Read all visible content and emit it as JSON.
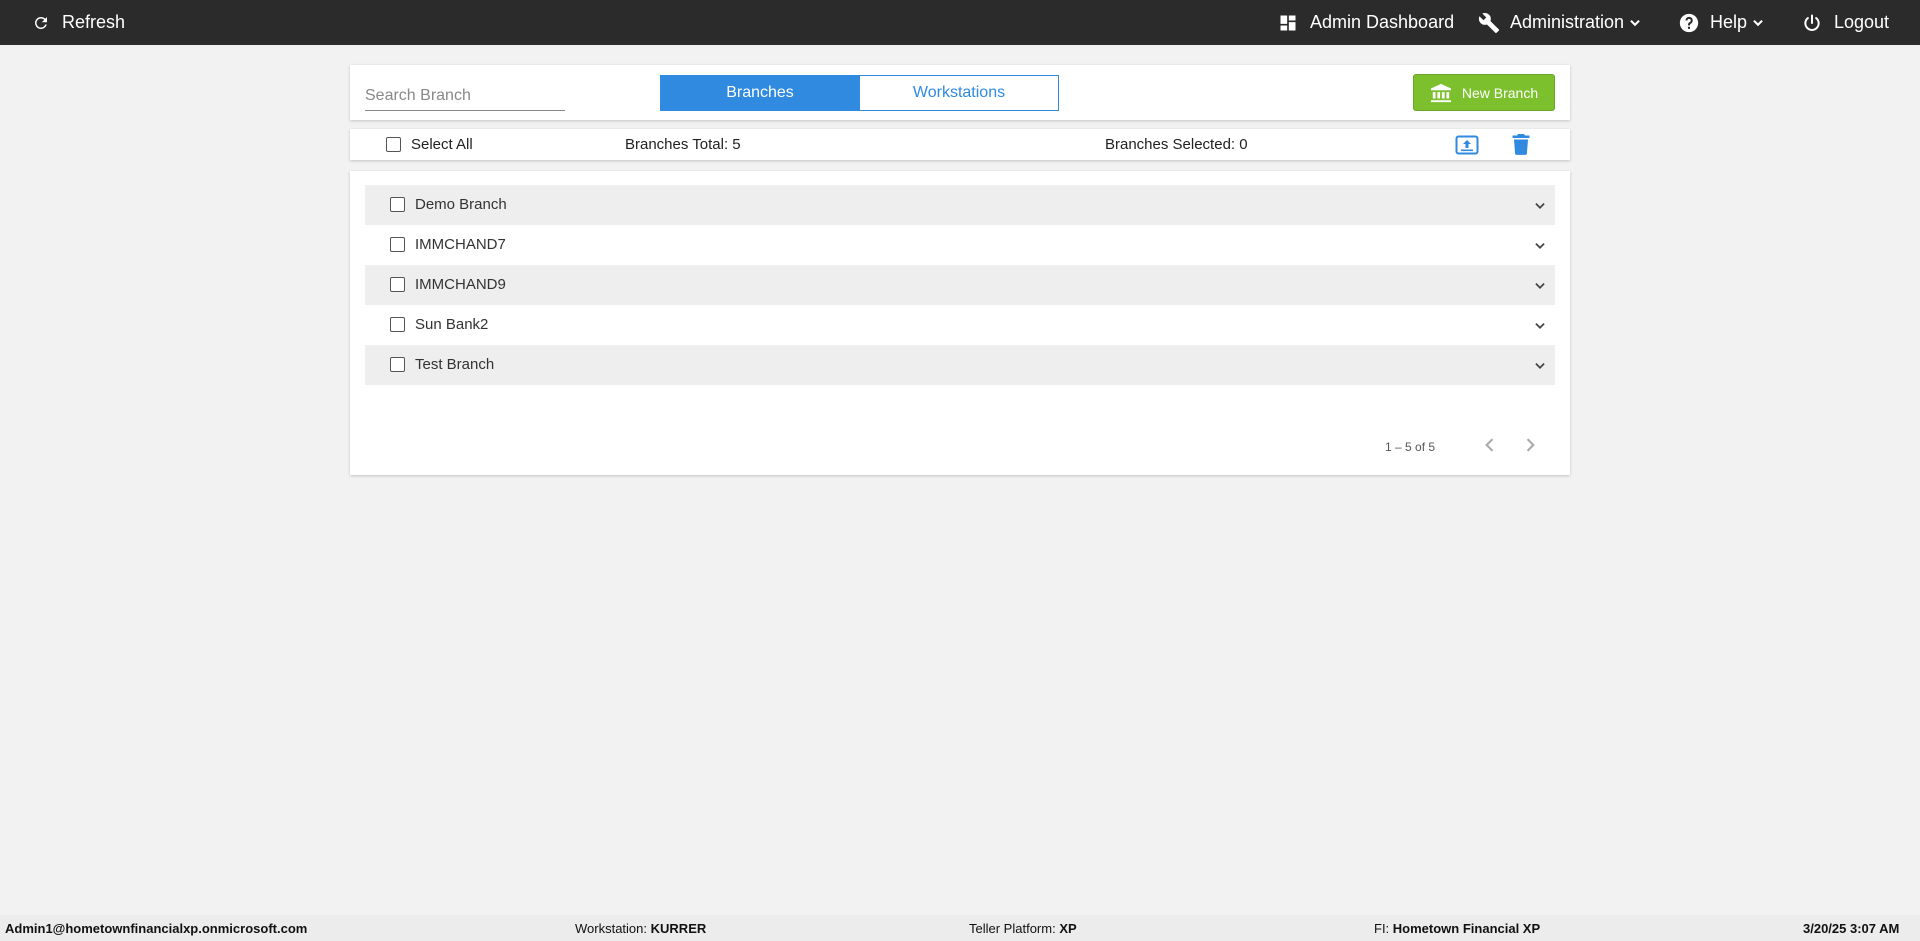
{
  "topbar": {
    "refresh_label": "Refresh",
    "admin_dashboard_label": "Admin Dashboard",
    "administration_label": "Administration",
    "help_label": "Help",
    "logout_label": "Logout"
  },
  "header": {
    "search_placeholder": "Search Branch",
    "tabs": [
      {
        "label": "Branches",
        "active": true
      },
      {
        "label": "Workstations",
        "active": false
      }
    ],
    "new_branch_label": "New Branch"
  },
  "toolbar": {
    "select_all_label": "Select All",
    "branches_total": "Branches Total: 5",
    "branches_selected": "Branches Selected: 0"
  },
  "branches": [
    {
      "name": "Demo Branch"
    },
    {
      "name": "IMMCHAND7"
    },
    {
      "name": "IMMCHAND9"
    },
    {
      "name": "Sun Bank2"
    },
    {
      "name": "Test Branch"
    }
  ],
  "pager": {
    "range_text": "1 – 5 of 5"
  },
  "statusbar": {
    "user": "Admin1@hometownfinancialxp.onmicrosoft.com",
    "workstation_label": "Workstation:",
    "workstation_value": "KURRER",
    "teller_platform_label": "Teller Platform:",
    "teller_platform_value": "XP",
    "fi_label": "FI:",
    "fi_value": "Hometown Financial XP",
    "datetime": "3/20/25 3:07 AM"
  },
  "colors": {
    "topbar_bg": "#2b2b2b",
    "accent_blue": "#2f8ae0",
    "new_branch_green": "#7cc02e",
    "page_bg": "#f2f2f2"
  },
  "icons": {
    "refresh": "refresh-icon",
    "dashboard": "dashboard-icon",
    "administration": "wrench-icon",
    "help": "help-circle-icon",
    "logout": "power-icon",
    "new_branch": "bank-icon",
    "export": "upload-box-icon",
    "delete": "trash-icon",
    "expand": "chevron-down-icon"
  }
}
